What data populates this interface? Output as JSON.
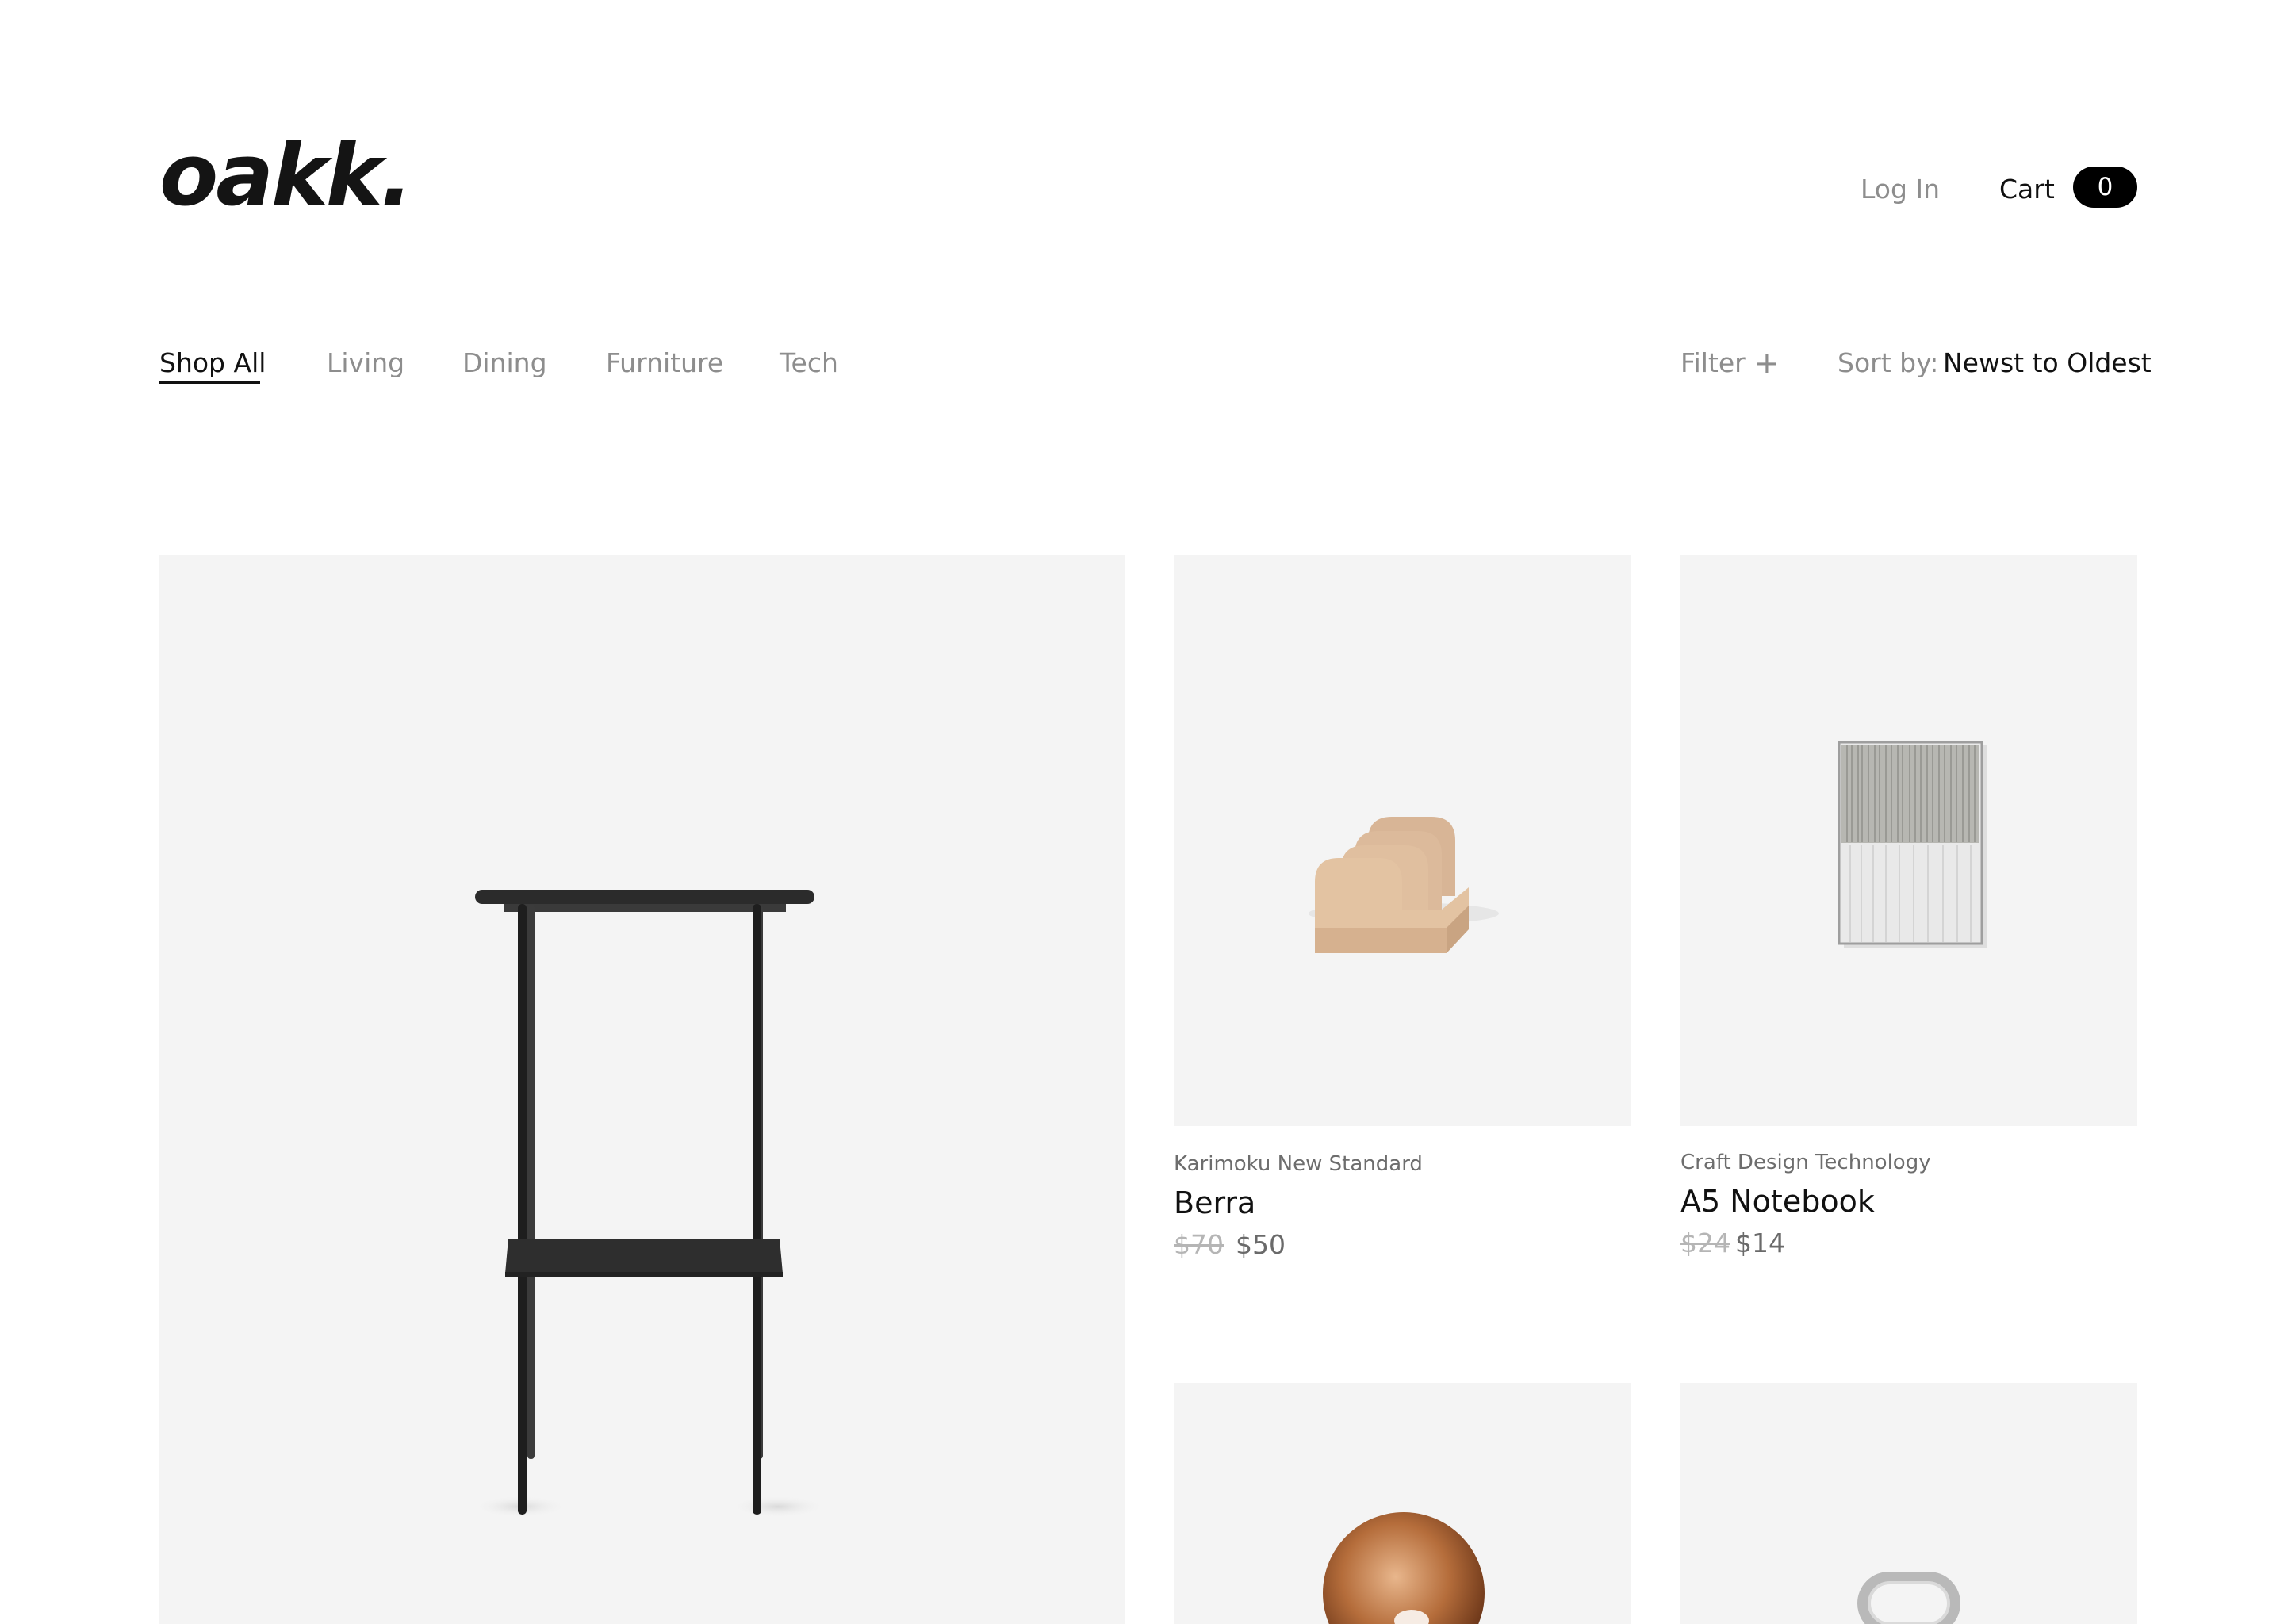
{
  "brand": {
    "logo": "oakk."
  },
  "header": {
    "login_label": "Log In",
    "cart_label": "Cart",
    "cart_count": "0"
  },
  "nav": {
    "categories": [
      {
        "label": "Shop All",
        "active": true
      },
      {
        "label": "Living",
        "active": false
      },
      {
        "label": "Dining",
        "active": false
      },
      {
        "label": "Furniture",
        "active": false
      },
      {
        "label": "Tech",
        "active": false
      }
    ],
    "filter_label": "Filter",
    "filter_icon": "plus-icon",
    "sort_label": "Sort by:",
    "sort_value": "Newst to Oldest"
  },
  "products": [
    {
      "image": "black-metal-side-table"
    },
    {
      "image": "wooden-wave-holder",
      "brand": "Karimoku New Standard",
      "name": "Berra",
      "old_price": "$70",
      "price": "$50"
    },
    {
      "image": "striped-a5-notebook",
      "brand": "Craft Design Technology",
      "name": "A5 Notebook",
      "old_price": "$24",
      "price": "$14"
    },
    {
      "image": "copper-round-object"
    },
    {
      "image": "glass-oval-object"
    }
  ],
  "colors": {
    "background": "#ffffff",
    "tile": "#f4f4f4",
    "text": "#111111",
    "muted": "#8d8d8d",
    "badge": "#000000"
  }
}
